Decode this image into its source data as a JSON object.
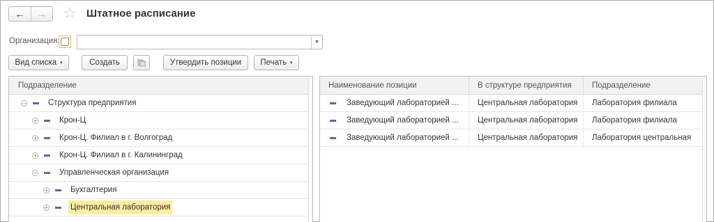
{
  "header": {
    "back_label": "←",
    "forward_label": "→",
    "star_label": "☆",
    "title": "Штатное расписание"
  },
  "filter": {
    "org_label": "Организация:",
    "org_value": ""
  },
  "toolbar": {
    "view_list_label": "Вид списка",
    "create_label": "Создать",
    "approve_label": "Утвердить позиции",
    "print_label": "Печать",
    "caret": "▾"
  },
  "tree": {
    "header": "Подразделение",
    "rows": [
      {
        "label": "Структура предприятия",
        "expander": "⊖"
      },
      {
        "label": "Крон-Ц",
        "expander": "⊕"
      },
      {
        "label": "Крон-Ц. Филиал в г. Волгоград",
        "expander": "⊕"
      },
      {
        "label": "Крон-Ц. Филиал в г. Калининград",
        "expander": "⊕"
      },
      {
        "label": "Управленческая организация",
        "expander": "⊖"
      },
      {
        "label": "Бухгалтерия",
        "expander": "⊕"
      },
      {
        "label": "Центральная лаборатория",
        "expander": "⊕",
        "selected": true
      }
    ]
  },
  "grid": {
    "columns": [
      "Наименование позиции",
      "В структуре предприятия",
      "Подразделение"
    ],
    "rows": [
      [
        "Заведующий лабораторией ...",
        "Центральная лаборатория",
        "Лаборатория филиала"
      ],
      [
        "Заведующий лабораторией ...",
        "Центральная лаборатория",
        "Лаборатория филиала"
      ],
      [
        "Заведующий лабораторией ...",
        "Центральная лаборатория",
        "Лаборатория центральная"
      ]
    ]
  },
  "colors": {
    "accent_selected": "#fbeca1",
    "item_icon": "#4e6fa6",
    "checkbox_focus": "#e2b94a"
  }
}
